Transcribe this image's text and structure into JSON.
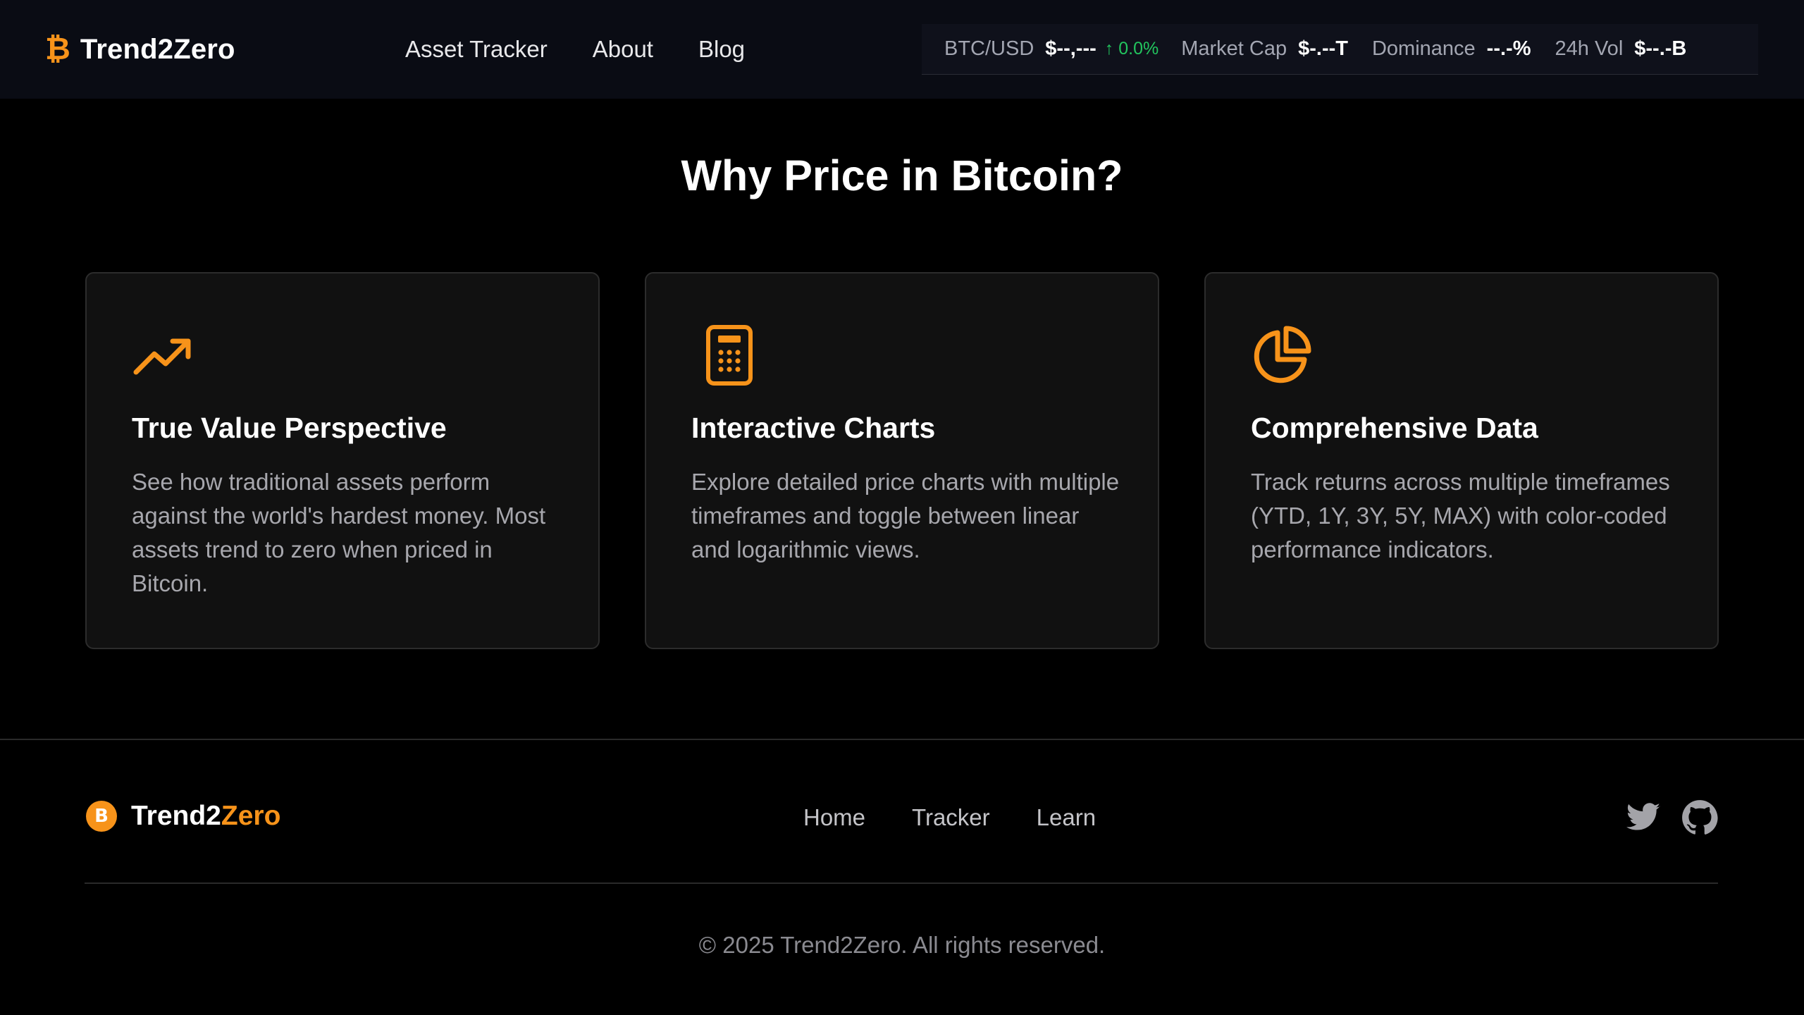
{
  "header": {
    "brand_glyph": "₿",
    "brand_name": "Trend2Zero",
    "nav": [
      "Asset Tracker",
      "About",
      "Blog"
    ]
  },
  "ticker": {
    "btc_label": "BTC/USD",
    "btc_value": "$--,---",
    "btc_change": "↑ 0.0%",
    "mcap_label": "Market Cap",
    "mcap_value": "$-.--T",
    "dom_label": "Dominance",
    "dom_value": "--.-%",
    "vol_label": "24h Vol",
    "vol_value": "$--.-B"
  },
  "section": {
    "title": "Why Price in Bitcoin?"
  },
  "cards": [
    {
      "icon": "trending-up-icon",
      "title": "True Value Perspective",
      "body": "See how traditional assets perform against the world's hardest money. Most assets trend to zero when priced in Bitcoin."
    },
    {
      "icon": "calculator-icon",
      "title": "Interactive Charts",
      "body": "Explore detailed price charts with multiple timeframes and toggle between linear and logarithmic views."
    },
    {
      "icon": "pie-chart-icon",
      "title": "Comprehensive Data",
      "body": "Track returns across multiple timeframes (YTD, 1Y, 3Y, 5Y, MAX) with color-coded performance indicators."
    }
  ],
  "footer": {
    "coin_glyph": "B",
    "brand_a": "Trend2",
    "brand_b": "Zero",
    "nav": [
      "Home",
      "Tracker",
      "Learn"
    ],
    "social_icons": [
      "twitter-icon",
      "github-icon"
    ],
    "copyright": "© 2025 Trend2Zero. All rights reserved."
  },
  "colors": {
    "accent": "#f7931a",
    "positive": "#22c55e",
    "background": "#000000",
    "card": "#111111",
    "header": "#0a0c14"
  }
}
